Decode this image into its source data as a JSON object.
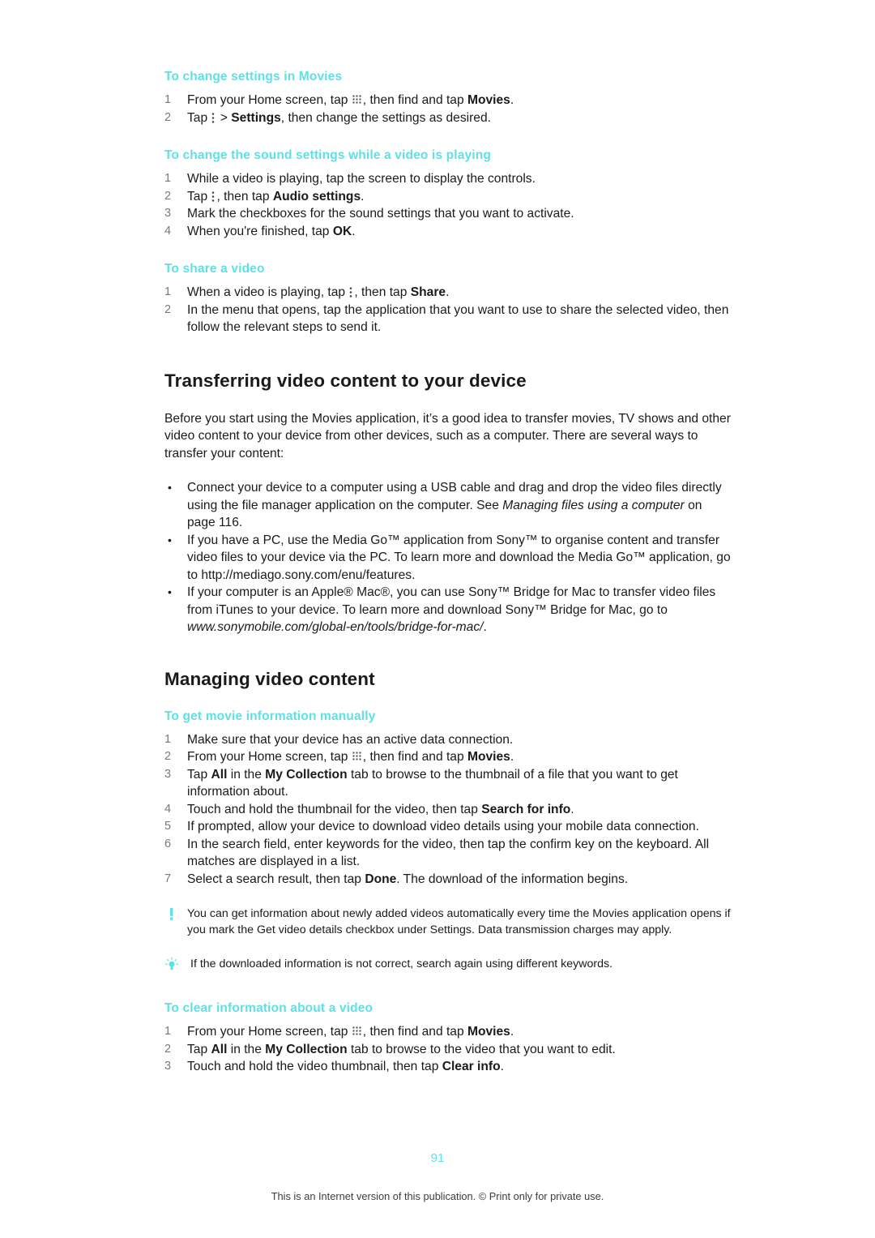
{
  "document": {
    "page_number": "91",
    "footer": "This is an Internet version of this publication. © Print only for private use.",
    "accent_color": "#5fe0e6"
  },
  "sections": {
    "change_settings_movies": {
      "heading": "To change settings in Movies",
      "steps": [
        "From your Home screen, tap ▦, then find and tap Movies.",
        "Tap ⋮ > Settings, then change the settings as desired."
      ]
    },
    "change_sound_settings": {
      "heading": "To change the sound settings while a video is playing",
      "steps": [
        "While a video is playing, tap the screen to display the controls.",
        "Tap ⋮, then tap Audio settings.",
        "Mark the checkboxes for the sound settings that you want to activate.",
        "When you're finished, tap OK."
      ]
    },
    "share_video": {
      "heading": "To share a video",
      "steps": [
        "When a video is playing, tap ⋮, then tap Share.",
        "In the menu that opens, tap the application that you want to use to share the selected video, then follow the relevant steps to send it."
      ]
    },
    "transferring": {
      "heading": "Transferring video content to your device",
      "intro": "Before you start using the Movies application, it’s a good idea to transfer movies, TV shows and other video content to your device from other devices, such as a computer. There are several ways to transfer your content:",
      "bullets": [
        "Connect your device to a computer using a USB cable and drag and drop the video files directly using the file manager application on the computer. See Managing files using a computer on page 116.",
        "If you have a PC, use the Media Go™ application from Sony™ to organise content and transfer video files to your device via the PC. To learn more and download the Media Go™ application, go to http://mediago.sony.com/enu/features.",
        "If your computer is an Apple® Mac®, you can use Sony™ Bridge for Mac to transfer video files from iTunes to your device. To learn more and download Sony™ Bridge for Mac, go to www.sonymobile.com/global-en/tools/bridge-for-mac/."
      ]
    },
    "managing": {
      "heading": "Managing video content"
    },
    "movie_info": {
      "heading": "To get movie information manually",
      "steps": [
        "Make sure that your device has an active data connection.",
        "From your Home screen, tap ▦, then find and tap Movies.",
        "Tap All in the My Collection tab to browse to the thumbnail of a file that you want to get information about.",
        "Touch and hold the thumbnail for the video, then tap Search for info.",
        "If prompted, allow your device to download video details using your mobile data connection.",
        "In the search field, enter keywords for the video, then tap the confirm key on the keyboard. All matches are displayed in a list.",
        "Select a search result, then tap Done. The download of the information begins."
      ],
      "note_warning": "You can get information about newly added videos automatically every time the Movies application opens if you mark the Get video details checkbox under Settings. Data transmission charges may apply.",
      "note_tip": "If the downloaded information is not correct, search again using different keywords."
    },
    "clear_info": {
      "heading": "To clear information about a video",
      "steps": [
        "From your Home screen, tap ▦, then find and tap Movies.",
        "Tap All in the My Collection tab to browse to the video that you want to edit.",
        "Touch and hold the video thumbnail, then tap Clear info."
      ]
    }
  }
}
